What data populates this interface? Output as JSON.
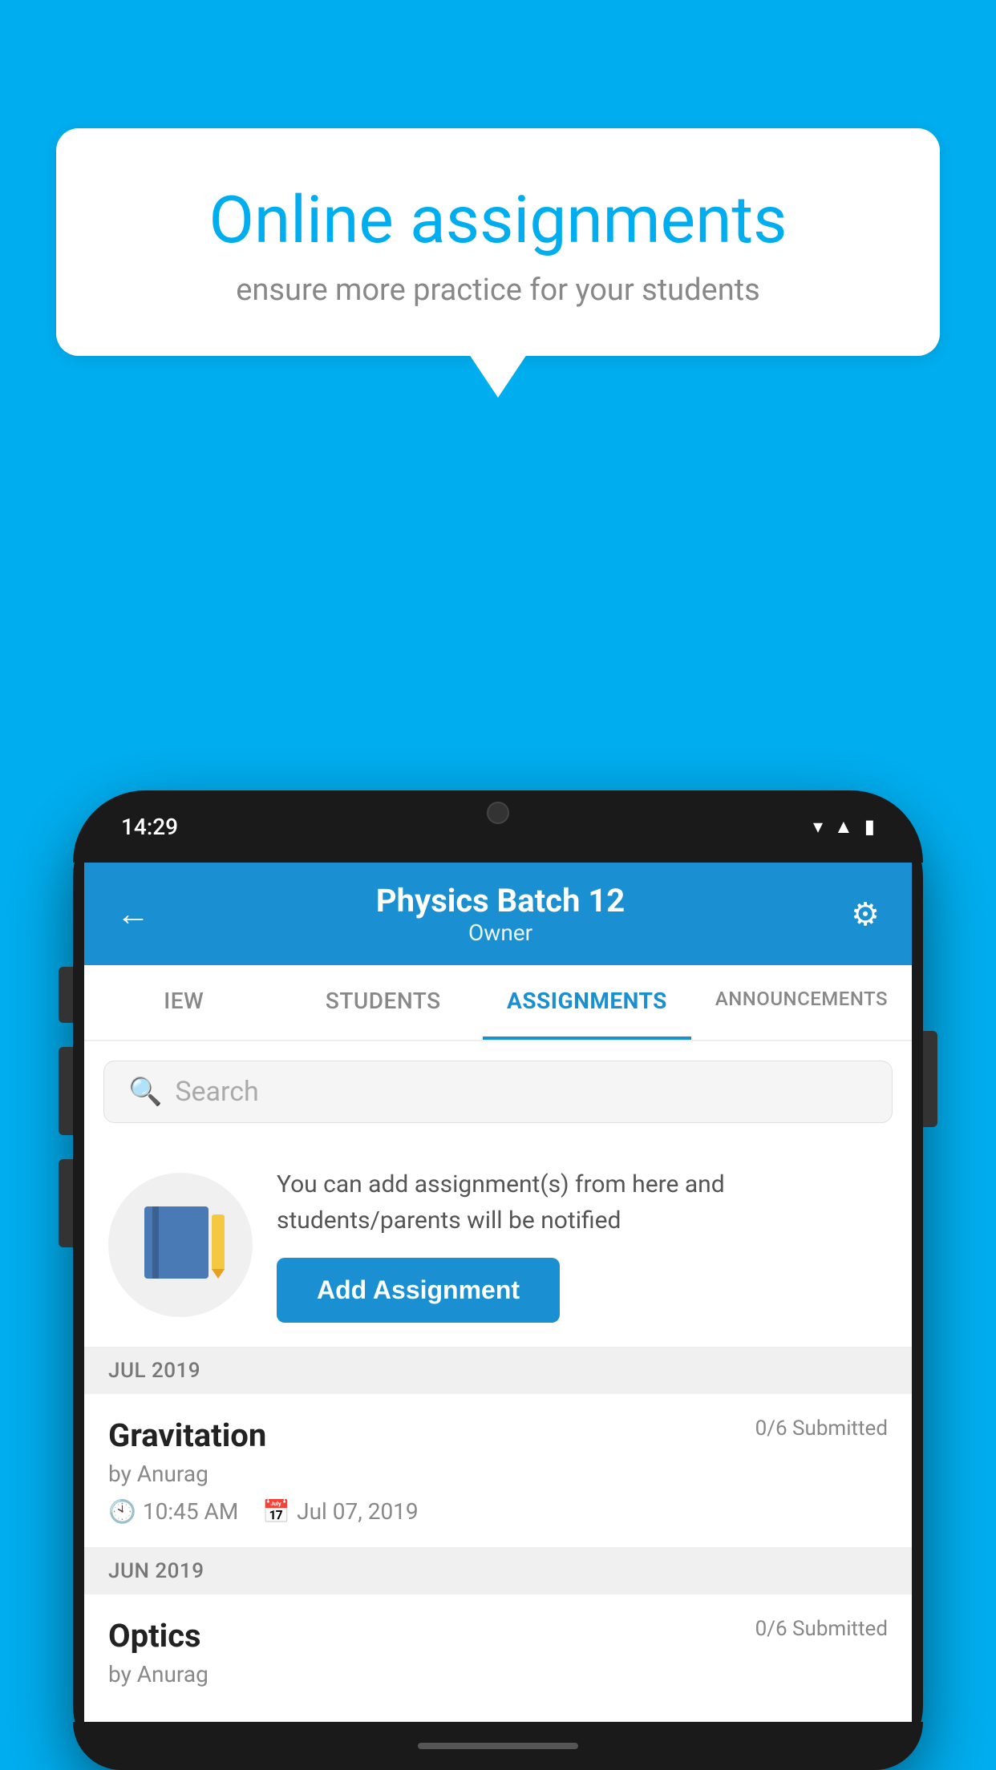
{
  "background": {
    "color": "#00AEEF"
  },
  "speech_bubble": {
    "title": "Online assignments",
    "subtitle": "ensure more practice for your students"
  },
  "phone": {
    "status_bar": {
      "time": "14:29"
    },
    "header": {
      "title": "Physics Batch 12",
      "subtitle": "Owner",
      "back_label": "←",
      "settings_label": "⚙"
    },
    "tabs": [
      {
        "label": "IEW",
        "active": false
      },
      {
        "label": "STUDENTS",
        "active": false
      },
      {
        "label": "ASSIGNMENTS",
        "active": true
      },
      {
        "label": "ANNOUNCEMENTS",
        "active": false
      }
    ],
    "search": {
      "placeholder": "Search"
    },
    "add_assignment_promo": {
      "description": "You can add assignment(s) from here and students/parents will be notified",
      "button_label": "Add Assignment"
    },
    "assignment_groups": [
      {
        "month_label": "JUL 2019",
        "assignments": [
          {
            "name": "Gravitation",
            "submitted": "0/6 Submitted",
            "by": "by Anurag",
            "time": "10:45 AM",
            "date": "Jul 07, 2019"
          }
        ]
      },
      {
        "month_label": "JUN 2019",
        "assignments": [
          {
            "name": "Optics",
            "submitted": "0/6 Submitted",
            "by": "by Anurag",
            "time": "",
            "date": ""
          }
        ]
      }
    ]
  }
}
